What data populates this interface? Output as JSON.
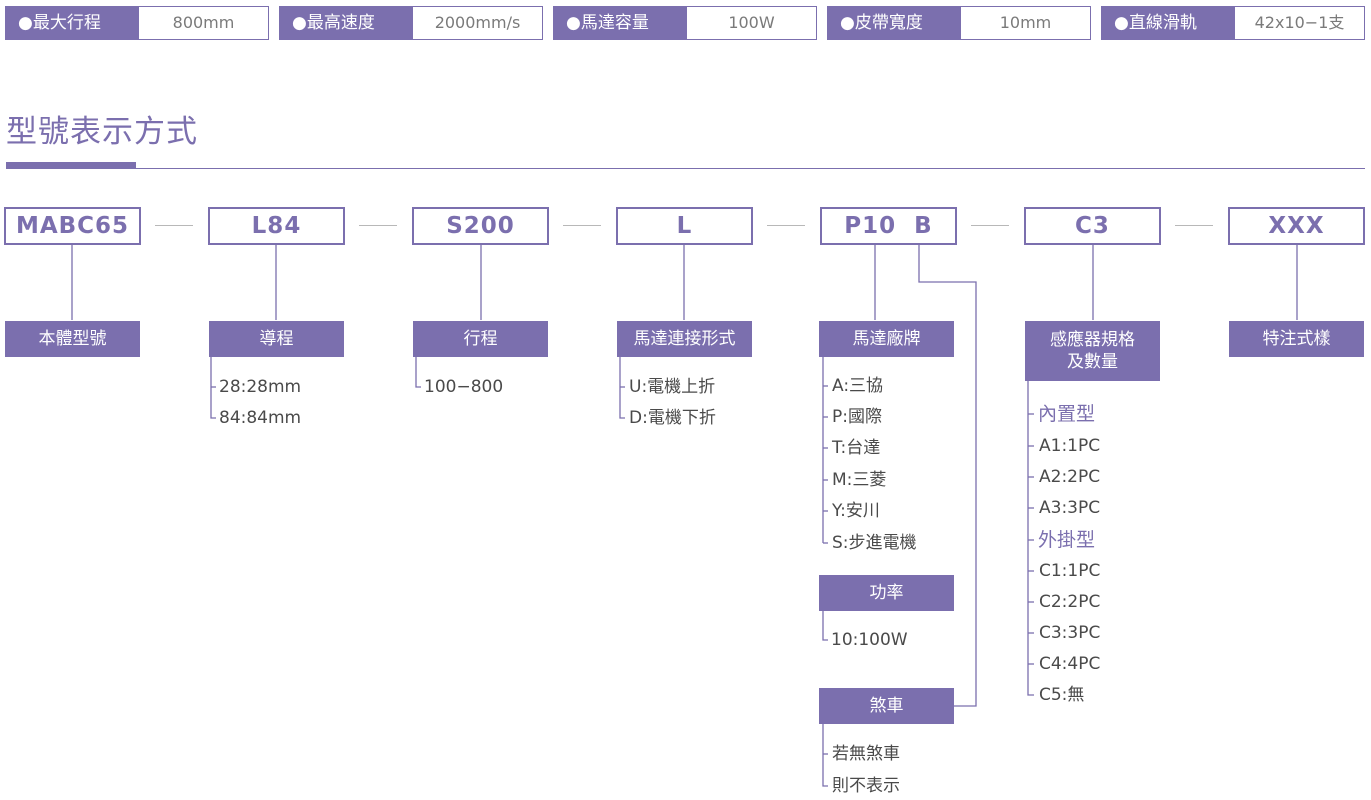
{
  "specs": [
    {
      "key": "●最大行程",
      "value": "800mm"
    },
    {
      "key": "●最高速度",
      "value": "2000mm/s"
    },
    {
      "key": "●馬達容量",
      "value": "100W"
    },
    {
      "key": "●皮帶寬度",
      "value": "10mm"
    },
    {
      "key": "●直線滑軌",
      "value": "42x10−1支"
    }
  ],
  "title": "型號表示方式",
  "codes": [
    "MABC65",
    "L84",
    "S200",
    "L",
    "P10  B",
    "C3",
    "XXX"
  ],
  "groups": {
    "body": {
      "label": "本體型號"
    },
    "lead": {
      "label": "導程",
      "options": [
        "28:28mm",
        "84:84mm"
      ]
    },
    "stroke": {
      "label": "行程",
      "options": [
        "100−800"
      ]
    },
    "mount": {
      "label": "馬達連接形式",
      "options": [
        "U:電機上折",
        "D:電機下折"
      ]
    },
    "brand": {
      "label": "馬達廠牌",
      "options": [
        "A:三協",
        "P:國際",
        "T:台達",
        "M:三菱",
        "Y:安川",
        "S:步進電機"
      ]
    },
    "power": {
      "label": "功率",
      "options": [
        "10:100W"
      ]
    },
    "brake": {
      "label": "煞車",
      "options": [
        "若無煞車",
        "則不表示"
      ]
    },
    "sensor": {
      "label_line1": "感應器規格",
      "label_line2": "及數量",
      "builtin_heading": "內置型",
      "builtin_options": [
        "A1:1PC",
        "A2:2PC",
        "A3:3PC"
      ],
      "external_heading": "外掛型",
      "external_options": [
        "C1:1PC",
        "C2:2PC",
        "C3:3PC",
        "C4:4PC",
        "C5:無"
      ]
    },
    "special": {
      "label": "特注式樣"
    }
  },
  "colors": {
    "accent": "#7b6fae",
    "text": "#4a4a4a",
    "connector": "#b8b8b8"
  }
}
